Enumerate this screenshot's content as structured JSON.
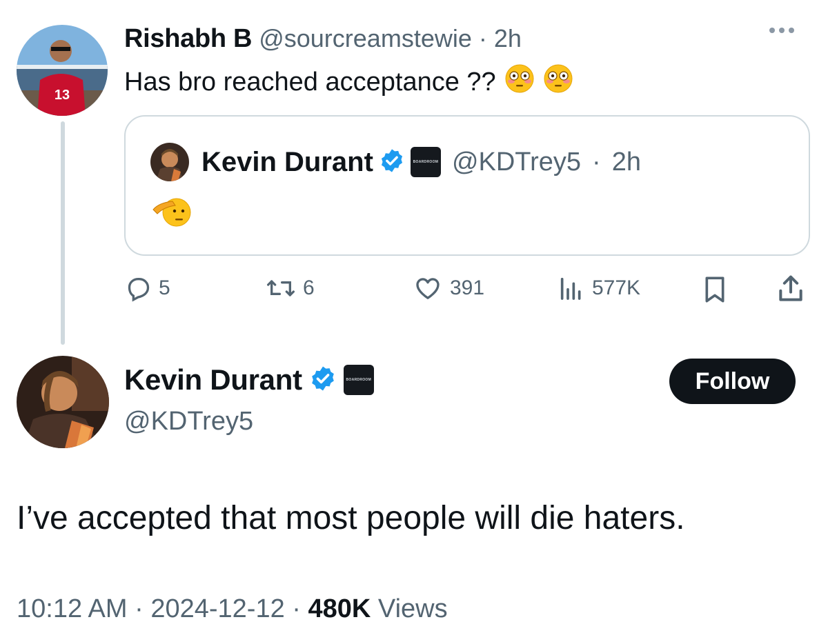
{
  "reply": {
    "name": "Rishabh B",
    "handle": "@sourcreamstewie",
    "separator": "·",
    "time": "2h",
    "text": "Has bro reached acceptance ??",
    "emojis": [
      "flushed-face",
      "flushed-face"
    ]
  },
  "quote": {
    "name": "Kevin Durant",
    "handle": "@KDTrey5",
    "separator": "·",
    "time": "2h",
    "affiliate_label": "BOARDROOM",
    "emoji": "saluting-face"
  },
  "actions": {
    "replies": "5",
    "reposts": "6",
    "likes": "391",
    "views": "577K"
  },
  "main": {
    "name": "Kevin Durant",
    "handle": "@KDTrey5",
    "affiliate_label": "BOARDROOM",
    "follow_label": "Follow",
    "text": "I’ve accepted that most people will die haters.",
    "time": "10:12 AM",
    "sep1": "·",
    "date": "2024-12-12",
    "sep2": "·",
    "views_count": "480K",
    "views_label": "Views"
  },
  "colors": {
    "verified": "#1d9bf0",
    "muted": "#536471",
    "text": "#0f1419",
    "border": "#cfd9de"
  }
}
